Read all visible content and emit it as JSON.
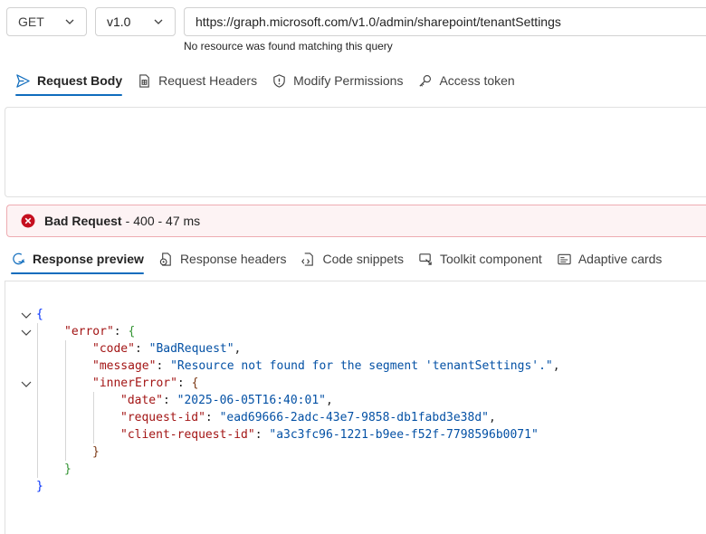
{
  "query": {
    "method": "GET",
    "version": "v1.0",
    "url": "https://graph.microsoft.com/v1.0/admin/sharepoint/tenantSettings",
    "message": "No resource was found matching this query"
  },
  "request_tabs": [
    {
      "label": "Request Body",
      "icon": "send-icon",
      "active": true
    },
    {
      "label": "Request Headers",
      "icon": "document-icon",
      "active": false
    },
    {
      "label": "Modify Permissions",
      "icon": "shield-icon",
      "active": false
    },
    {
      "label": "Access token",
      "icon": "key-icon",
      "active": false
    }
  ],
  "status": {
    "title": "Bad Request",
    "separator": "-",
    "detail": "400 - 47 ms",
    "color": "#c50f1f"
  },
  "response_tabs": [
    {
      "label": "Response preview",
      "icon": "preview-icon",
      "active": true
    },
    {
      "label": "Response headers",
      "icon": "headers-icon",
      "active": false
    },
    {
      "label": "Code snippets",
      "icon": "code-icon",
      "active": false
    },
    {
      "label": "Toolkit component",
      "icon": "toolkit-icon",
      "active": false
    },
    {
      "label": "Adaptive cards",
      "icon": "card-icon",
      "active": false
    }
  ],
  "response": {
    "code_key": "\"code\"",
    "code_value": "\"BadRequest\"",
    "message_key": "\"message\"",
    "message_value": "\"Resource not found for the segment 'tenantSettings'.\"",
    "error_key": "\"error\"",
    "inner_key": "\"innerError\"",
    "date_key": "\"date\"",
    "date_value": "\"2025-06-05T16:40:01\"",
    "request_id_key": "\"request-id\"",
    "request_id_value": "\"ead69666-2adc-43e7-9858-db1fabd3e38d\"",
    "client_request_id_key": "\"client-request-id\"",
    "client_request_id_value": "\"a3c3fc96-1221-b9ee-f52f-7798596b0071\""
  },
  "colors": {
    "accent": "#0f6cbd",
    "error_bg": "#fdf3f4",
    "error_border": "#eeacb2"
  }
}
